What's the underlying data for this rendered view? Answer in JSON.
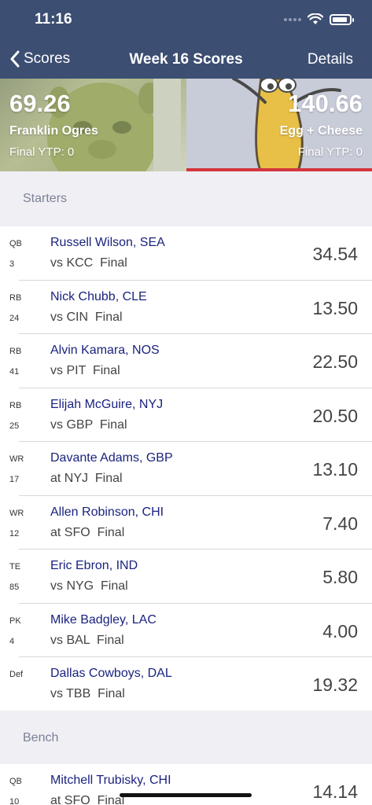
{
  "status": {
    "time": "11:16"
  },
  "nav": {
    "back_label": "Scores",
    "title": "Week 16 Scores",
    "details_label": "Details"
  },
  "matchup": {
    "home": {
      "score": "69.26",
      "name": "Franklin Ogres",
      "ytp": "Final YTP: 0"
    },
    "away": {
      "score": "140.66",
      "name": "Egg + Cheese",
      "ytp": "Final YTP: 0"
    }
  },
  "sections": {
    "starters": "Starters",
    "bench": "Bench"
  },
  "starters": [
    {
      "pos": "QB",
      "num": "3",
      "player": "Russell Wilson, SEA",
      "game": "vs KCC  Final",
      "pts": "34.54"
    },
    {
      "pos": "RB",
      "num": "24",
      "player": "Nick Chubb, CLE",
      "game": "vs CIN  Final",
      "pts": "13.50"
    },
    {
      "pos": "RB",
      "num": "41",
      "player": "Alvin Kamara, NOS",
      "game": "vs PIT  Final",
      "pts": "22.50"
    },
    {
      "pos": "RB",
      "num": "25",
      "player": "Elijah McGuire, NYJ",
      "game": "vs GBP  Final",
      "pts": "20.50"
    },
    {
      "pos": "WR",
      "num": "17",
      "player": "Davante Adams, GBP",
      "game": "at NYJ  Final",
      "pts": "13.10"
    },
    {
      "pos": "WR",
      "num": "12",
      "player": "Allen Robinson, CHI",
      "game": "at SFO  Final",
      "pts": "7.40"
    },
    {
      "pos": "TE",
      "num": "85",
      "player": "Eric Ebron, IND",
      "game": "vs NYG  Final",
      "pts": "5.80"
    },
    {
      "pos": "PK",
      "num": "4",
      "player": "Mike Badgley, LAC",
      "game": "vs BAL  Final",
      "pts": "4.00"
    },
    {
      "pos": "Def",
      "num": "",
      "player": "Dallas Cowboys, DAL",
      "game": "vs TBB  Final",
      "pts": "19.32"
    }
  ],
  "bench": [
    {
      "pos": "QB",
      "num": "10",
      "player": "Mitchell Trubisky, CHI",
      "game": "at SFO  Final",
      "pts": "14.14"
    }
  ],
  "colors": {
    "nav_bg": "#3c4e72",
    "player_link": "#1a237e",
    "accent_red": "#d4353d"
  }
}
